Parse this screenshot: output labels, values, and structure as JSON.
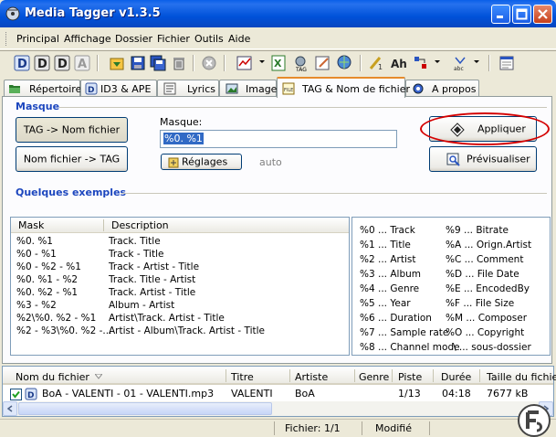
{
  "window": {
    "title": "Media Tagger v1.3.5"
  },
  "menu": [
    "Principal",
    "Affichage",
    "Dossier",
    "Fichier",
    "Outils",
    "Aide"
  ],
  "tabs": [
    "Répertoire",
    "ID3 & APE",
    "Lyrics",
    "Image",
    "TAG & Nom de fichier",
    "A propos"
  ],
  "active_tab": "TAG & Nom de fichier",
  "masque": {
    "group_title": "Masque",
    "tag_to_name_button": "TAG -> Nom fichier",
    "name_to_tag_button": "Nom fichier -> TAG",
    "mask_label": "Masque:",
    "mask_value": "%0. %1",
    "settings_button": "Réglages",
    "auto_label": "auto",
    "apply_button": "Appliquer",
    "preview_button": "Prévisualiser"
  },
  "examples": {
    "group_title": "Quelques exemples",
    "columns": [
      "Mask",
      "Description"
    ],
    "rows": [
      {
        "mask": "%0. %1",
        "desc": "Track. Title"
      },
      {
        "mask": "%0 - %1",
        "desc": "Track - Title"
      },
      {
        "mask": "%0 - %2 - %1",
        "desc": "Track - Artist - Title"
      },
      {
        "mask": "%0. %1 - %2",
        "desc": "Track. Title - Artist"
      },
      {
        "mask": "%0. %2 - %1",
        "desc": "Track. Artist - Title"
      },
      {
        "mask": "%3 - %2",
        "desc": "Album - Artist"
      },
      {
        "mask": "%2\\%0. %2 - %1",
        "desc": "Artist\\Track. Artist - Title"
      },
      {
        "mask": "%2 - %3\\%0. %2 -...",
        "desc": "Artist - Album\\Track. Artist - Title"
      }
    ]
  },
  "codes_left": [
    "%0 ... Track",
    "%1 ... Title",
    "%2 ... Artist",
    "%3 ... Album",
    "%4 ... Genre",
    "%5 ... Year",
    "%6 ... Duration",
    "%7 ... Sample rate",
    "%8 ... Channel mode"
  ],
  "codes_right": [
    "%9 ... Bitrate",
    "%A ... Orign.Artist",
    "%C ... Comment",
    "%D ... File Date",
    "%E ... EncodedBy",
    "%F ... File Size",
    "%M ... Composer",
    "%O ... Copyright",
    "\\ ... sous-dossier"
  ],
  "filelist": {
    "columns": [
      "Nom du fichier",
      "Titre",
      "Artiste",
      "Genre",
      "Piste",
      "Durée",
      "Taille du fichier"
    ],
    "row": {
      "filename": "BoA - VALENTI - 01 - VALENTI.mp3",
      "title": "VALENTI",
      "artist": "BoA",
      "genre": "",
      "track": "1/13",
      "duration": "04:18",
      "size": "7677 kB",
      "checked": true
    }
  },
  "status": {
    "files": "Fichier: 1/1",
    "state": "Modifié"
  },
  "colors": {
    "titlebar": "#0054e3",
    "group_title": "#1c46be",
    "selection": "#316ac5",
    "highlight_circle": "#d40000",
    "active_tab_accent": "#e68b2c"
  }
}
